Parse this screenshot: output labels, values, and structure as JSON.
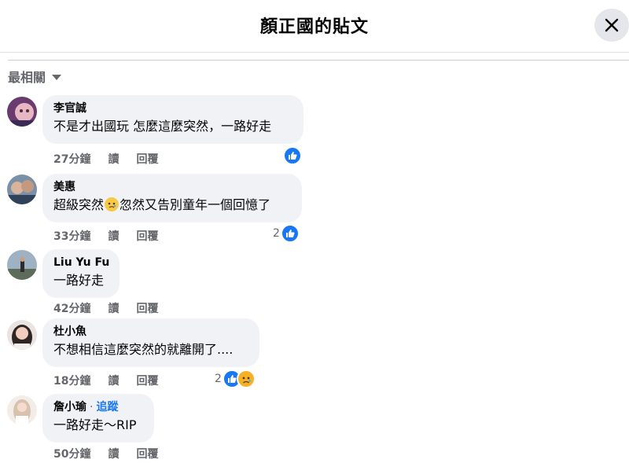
{
  "header": {
    "title": "顏正國的貼文",
    "close_icon": "close-icon"
  },
  "sort": {
    "label": "最相關"
  },
  "comments": [
    {
      "name": "李官誠",
      "text": "不是才出國玩 怎麼這麼突然，一路好走",
      "time": "27分鐘",
      "read": "讀",
      "reply": "回覆",
      "like_count": "",
      "reactions": [
        "like"
      ]
    },
    {
      "name": "美惠",
      "text_before": "超級突然",
      "text_after": "忽然又告別童年一個回憶了",
      "time": "33分鐘",
      "read": "讀",
      "reply": "回覆",
      "like_count": "2",
      "reactions": [
        "like"
      ]
    },
    {
      "name": "Liu Yu Fu",
      "text": "一路好走",
      "time": "42分鐘",
      "read": "讀",
      "reply": "回覆",
      "like_count": "",
      "reactions": []
    },
    {
      "name": "杜小魚",
      "text": "不想相信這麼突然的就離開了....",
      "time": "18分鐘",
      "read": "讀",
      "reply": "回覆",
      "like_count": "2",
      "reactions": [
        "like",
        "sad"
      ]
    },
    {
      "name": "詹小瑜",
      "follow": "追蹤",
      "text": "一路好走～RIP",
      "time": "50分鐘",
      "read": "讀",
      "reply": "回覆",
      "like_count": "",
      "reactions": []
    }
  ],
  "colors": {
    "accent": "#1877f2",
    "bubble": "#f0f2f5",
    "muted": "#65676b"
  }
}
